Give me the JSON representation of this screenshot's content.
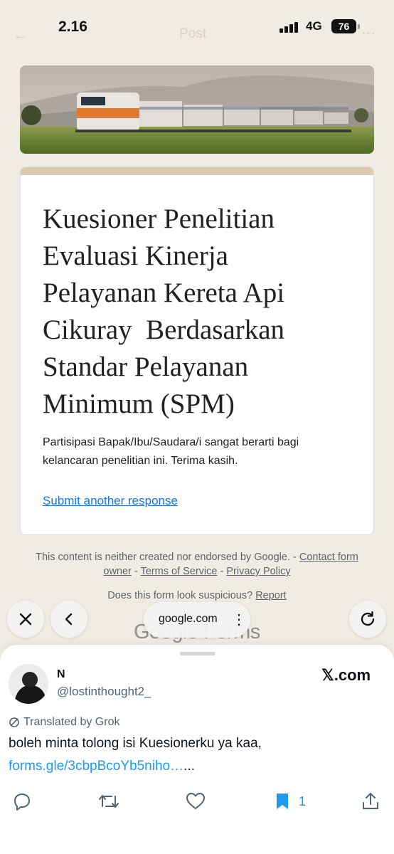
{
  "status_bar": {
    "time": "2.16",
    "network": "4G",
    "battery": "76",
    "ghost_title": "Post"
  },
  "form": {
    "title": "Kuesioner Penelitian\nEvaluasi Kinerja\nPelayanan Kereta Api\nCikuray  Berdasarkan\nStandar Pelayanan\nMinimum (SPM)",
    "description": "Partisipasi Bapak/Ibu/Saudara/i sangat berarti bagi kelancaran penelitian ini. Terima kasih.",
    "submit_another": "Submit another response",
    "header_color": "#dccbab"
  },
  "footer": {
    "disclaimer": "This content is neither created nor endorsed by Google. - ",
    "contact_owner": "Contact form owner",
    "sep1": " - ",
    "terms": "Terms of Service",
    "sep2": " - ",
    "privacy": "Privacy Policy",
    "suspicious": "Does this form look suspicious? ",
    "report": "Report",
    "google_forms": "Google Forms"
  },
  "browser": {
    "url": "google.com",
    "close_icon": "close-icon",
    "back_icon": "chevron-left-icon",
    "reload_icon": "reload-icon"
  },
  "tweet": {
    "author_name": "N",
    "author_handle": "@lostinthought2_",
    "source": "𝕏.com",
    "translated_label": "Translated by Grok",
    "text": "boleh minta tolong isi Kuesionerku ya kaa,",
    "link": "forms.gle/3cbpBcoYb5niho…",
    "link_suffix": "...",
    "bookmark_count": "1",
    "accent_color": "#1d9bf0"
  }
}
